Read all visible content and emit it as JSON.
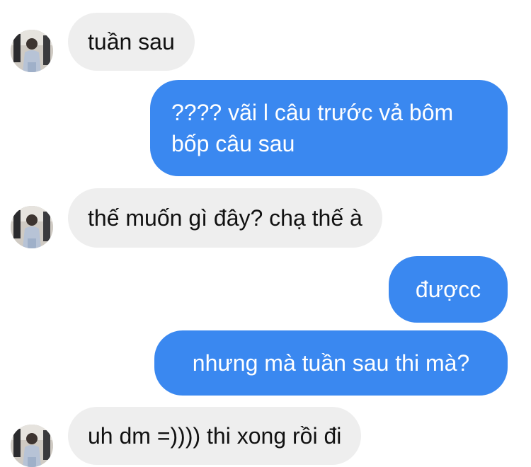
{
  "colors": {
    "incoming_bubble": "#eeeeee",
    "outgoing_bubble": "#3a88f0",
    "incoming_text": "#111111",
    "outgoing_text": "#ffffff"
  },
  "messages": [
    {
      "direction": "incoming",
      "text": "tuần sau",
      "avatar_icon": "profile-photo"
    },
    {
      "direction": "outgoing",
      "lines": [
        "???? vãi l câu trước vả bôm",
        "bốp câu sau"
      ]
    },
    {
      "direction": "incoming",
      "text": "thế muốn gì đây? chạ thế à",
      "avatar_icon": "profile-photo"
    },
    {
      "direction": "outgoing",
      "text": "đượcc"
    },
    {
      "direction": "outgoing",
      "text": "nhưng mà tuần sau thi mà?"
    },
    {
      "direction": "incoming",
      "text": "uh dm =)))) thi xong rồi đi",
      "avatar_icon": "profile-photo"
    }
  ]
}
